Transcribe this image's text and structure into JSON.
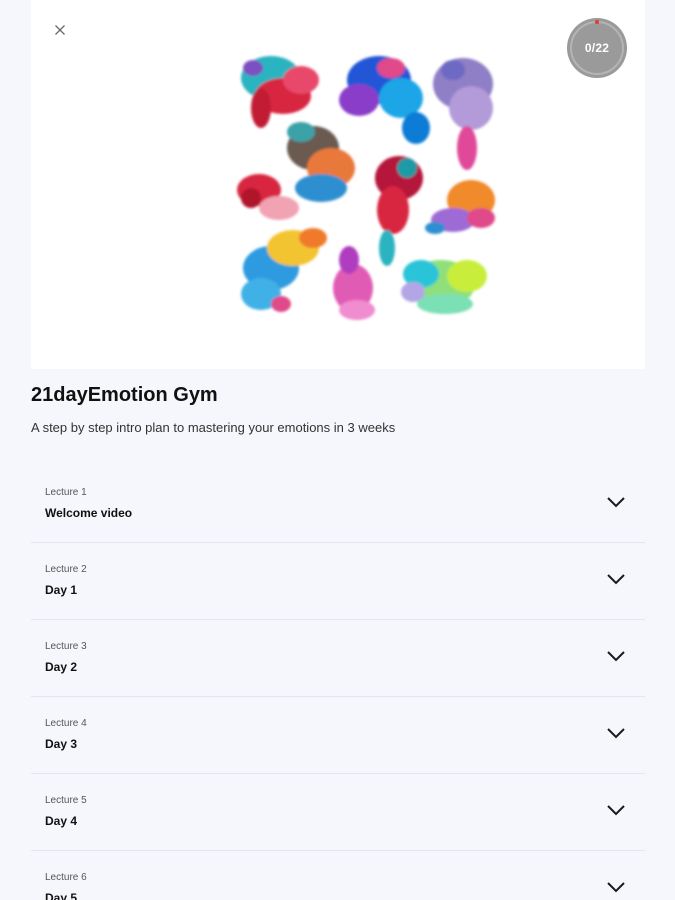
{
  "header": {
    "close_icon": "close-icon",
    "progress_label": "0/22",
    "progress_fraction": 0
  },
  "course": {
    "title": "21dayEmotion Gym",
    "description": "A step by step intro plan to mastering your emotions in 3 weeks"
  },
  "lectures": [
    {
      "number": "Lecture 1",
      "name": "Welcome video"
    },
    {
      "number": "Lecture 2",
      "name": "Day 1"
    },
    {
      "number": "Lecture 3",
      "name": "Day 2"
    },
    {
      "number": "Lecture 4",
      "name": "Day 3"
    },
    {
      "number": "Lecture 5",
      "name": "Day 4"
    },
    {
      "number": "Lecture 6",
      "name": "Day 5"
    }
  ],
  "colors": {
    "background": "#f6f7fc",
    "badge": "#9a9a9a",
    "badge_dot": "#e53935",
    "divider": "#e4e6ee"
  }
}
